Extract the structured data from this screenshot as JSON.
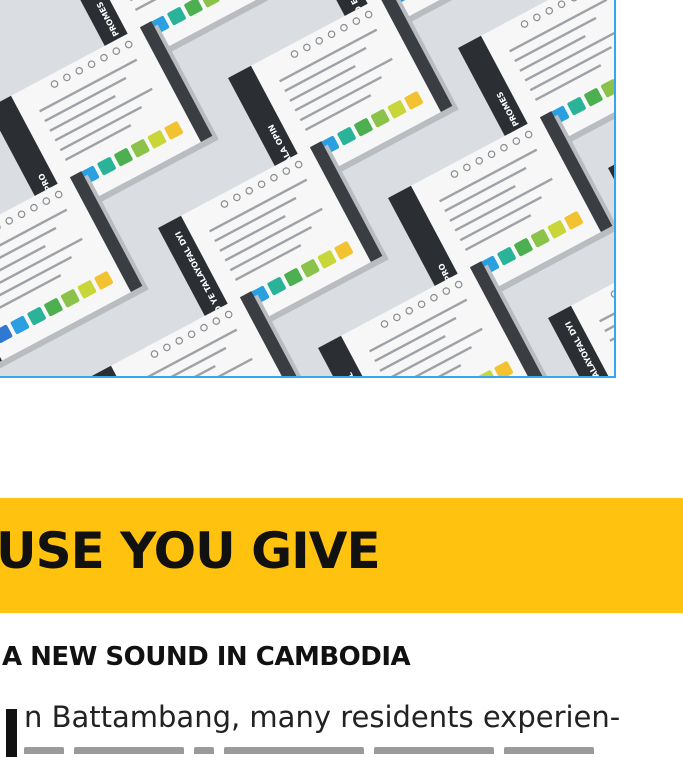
{
  "photo": {
    "alt_subject": "booklets",
    "card_titles": [
      "MI PROMES",
      "RO E TALAYOFAL",
      "GO YE TALAYOFAL DYI",
      "5 PRO",
      "BALA OPIN"
    ],
    "swatch_colors": [
      "#2f79d0",
      "#2aa0e0",
      "#2bb39a",
      "#4cb050",
      "#8bc34a",
      "#c8d63a",
      "#f2c230"
    ],
    "card_accent": "#2b2f33",
    "frame_color": "#35a7ec"
  },
  "banner": {
    "title": "USE YOU GIVE",
    "color": "#ffc20e"
  },
  "article": {
    "subtitle": "A NEW SOUND IN CAMBODIA",
    "first_line": "n Battambang, many residents experien-"
  }
}
